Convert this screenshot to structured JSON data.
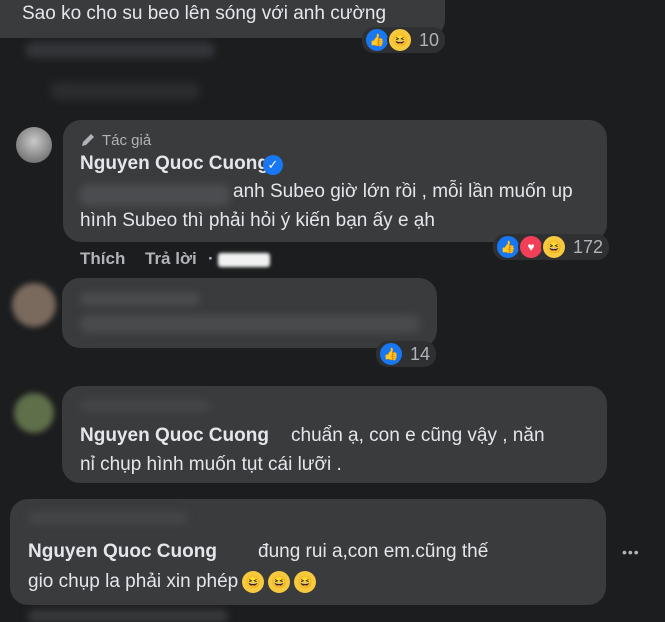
{
  "comment1": {
    "text": "Sao ko cho su beo lên sóng với anh cường",
    "reactions": {
      "icons": [
        "like-icon",
        "haha-icon"
      ],
      "count": "10"
    }
  },
  "reply_author": {
    "badge": "Tác giả",
    "name": "Nguyen Quoc Cuong",
    "line1": "anh Subeo giờ lớn rồi , mỗi lần muốn up",
    "line2": "hình Subeo thì phải hỏi ý kiến bạn ấy e ạh",
    "reactions": {
      "icons": [
        "like-icon",
        "love-icon",
        "haha-icon"
      ],
      "count": "172"
    },
    "actions": {
      "like": "Thích",
      "reply": "Trả lời",
      "sep": "·"
    }
  },
  "comment3": {
    "reactions": {
      "icons": [
        "like-icon"
      ],
      "count": "14"
    }
  },
  "comment4": {
    "name": "Nguyen Quoc Cuong",
    "line1": "chuẩn ạ, con e cũng vậy , năn",
    "line2": "nỉ chụp hình muốn tụt cái lưỡi ."
  },
  "comment5": {
    "name": "Nguyen Quoc Cuong",
    "line1": "đung rui a,con em.cũng thế",
    "line2": "gio chụp la phải xin phép",
    "emojis": [
      "😆",
      "😆",
      "😆"
    ],
    "more": "•••"
  },
  "colors": {
    "like": "#1877f2",
    "love": "#f33e58",
    "haha": "#f7c93e",
    "verified": "#1877f2",
    "bubble": "#3a3b3c"
  }
}
